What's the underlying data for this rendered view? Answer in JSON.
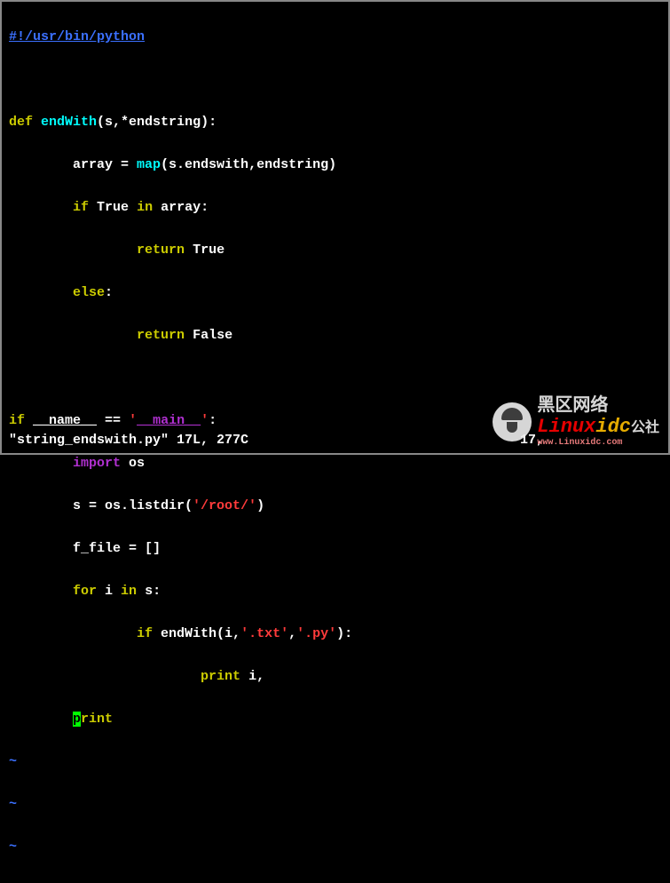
{
  "code": {
    "shebang": "#!/usr/bin/python",
    "def_kw": "def",
    "func_name": "endWith",
    "params": "(s,*endstring):",
    "l1_array": "array = ",
    "l1_map": "map",
    "l1_args": "(s.endswith,endstring)",
    "if_kw": "if",
    "true_kw": "True",
    "in_kw": "in",
    "array_ref": " array:",
    "return_kw": "return",
    "else_kw": "else",
    "false_kw": "False",
    "name_dunder": "__name__",
    "eq": " == ",
    "quote": "'",
    "main_str": "__main__",
    "colon": ":",
    "import_kw": "import",
    "os_mod": " os",
    "s_eq": "s = os.listdir(",
    "root_str": "'/root/'",
    "close_paren": ")",
    "ffile": "f_file = []",
    "for_kw": "for",
    "i_in_s": " i ",
    "in_kw2": "in",
    "s_colon": " s:",
    "endwith_call": " endWith(i,",
    "txt_str": "'.txt'",
    "comma": ",",
    "py_str": "'.py'",
    "close_call": "):",
    "print_kw": "print",
    "print_arg": " i,",
    "cursor_char": "p",
    "print_tail": "rint",
    "tilde": "~"
  },
  "status": {
    "file_info": "\"string_endswith.py\" 17L, 277C",
    "position": "17,"
  },
  "watermark": {
    "cn": "黑区网络",
    "brand_linux": "Linux",
    "brand_idc": "idc",
    "url": "www.Linuxidc.com",
    "suffix": "公社"
  }
}
